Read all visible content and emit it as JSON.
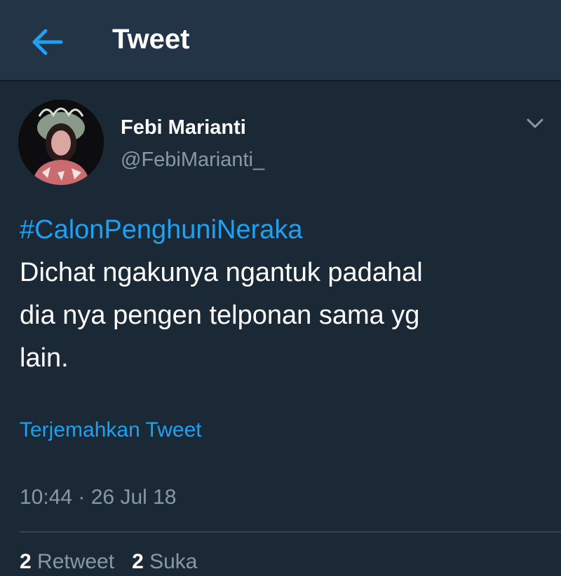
{
  "header": {
    "title": "Tweet",
    "back_icon": "arrow-left-icon"
  },
  "tweet": {
    "author": {
      "name": "Febi Marianti",
      "handle": "@FebiMarianti_"
    },
    "hashtag": "#CalonPenghuniNeraka",
    "line1": "Dichat ngakunya ngantuk padahal",
    "line2": "dia nya pengen telponan sama yg",
    "line3": "lain.",
    "translate": "Terjemahkan Tweet",
    "timestamp": "10:44 · 26 Jul 18",
    "stats": {
      "retweets_count": "2",
      "retweets_label": " Retweet",
      "likes_count": "2",
      "likes_label": " Suka"
    }
  },
  "colors": {
    "background": "#1b2836",
    "header": "#243447",
    "accent": "#1da1f2",
    "secondary_text": "#8899a6"
  }
}
